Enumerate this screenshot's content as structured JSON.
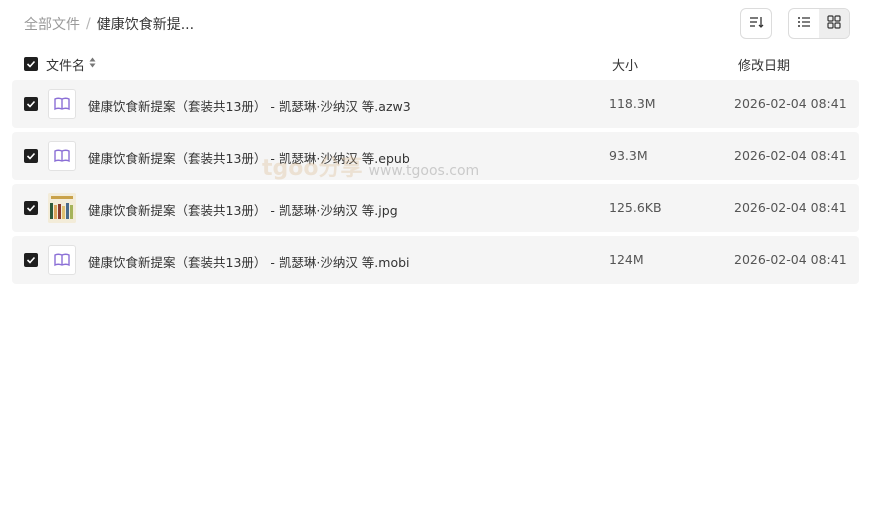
{
  "breadcrumb": {
    "root": "全部文件",
    "separator": "/",
    "current": "健康饮食新提..."
  },
  "toolbar": {
    "sort_icon": "sort-icon",
    "list_icon": "list-view-icon",
    "grid_icon": "grid-view-icon"
  },
  "header": {
    "name": "文件名",
    "size": "大小",
    "date": "修改日期"
  },
  "files": [
    {
      "name": "健康饮食新提案（套装共13册） - 凯瑟琳·沙纳汉 等.azw3",
      "size": "118.3M",
      "date": "2026-02-04 08:41",
      "icon": "book-icon"
    },
    {
      "name": "健康饮食新提案（套装共13册） - 凯瑟琳·沙纳汉 等.epub",
      "size": "93.3M",
      "date": "2026-02-04 08:41",
      "icon": "book-icon"
    },
    {
      "name": "健康饮食新提案（套装共13册） - 凯瑟琳·沙纳汉 等.jpg",
      "size": "125.6KB",
      "date": "2026-02-04 08:41",
      "icon": "image-thumbnail"
    },
    {
      "name": "健康饮食新提案（套装共13册） - 凯瑟琳·沙纳汉 等.mobi",
      "size": "124M",
      "date": "2026-02-04 08:41",
      "icon": "book-icon"
    }
  ],
  "watermark": {
    "brand": "tgoo分享",
    "url": "www.tgoos.com"
  },
  "colors": {
    "row_bg": "#f5f5f5",
    "checkbox": "#1f1f1f",
    "book_icon": "#8b6fd6"
  }
}
